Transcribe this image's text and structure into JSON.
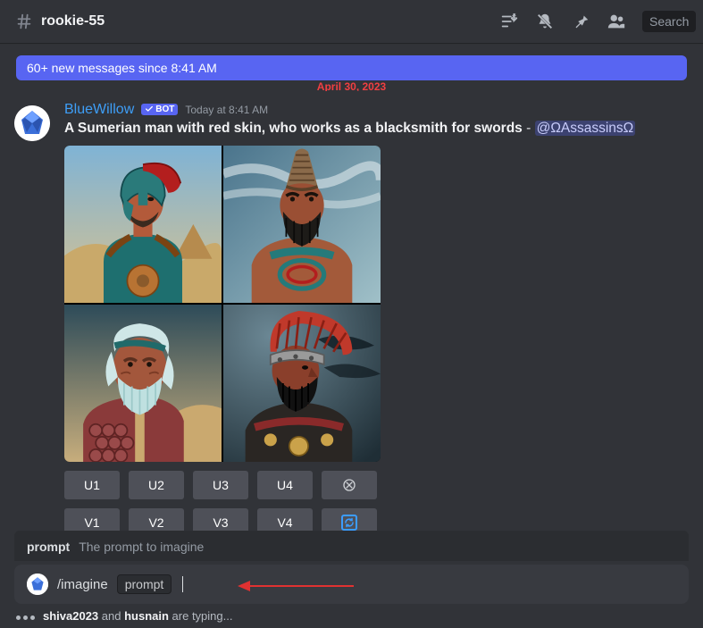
{
  "header": {
    "channel_name": "rookie-55",
    "search_placeholder": "Search"
  },
  "new_messages_bar": "60+ new messages since 8:41 AM",
  "date_divider": "April 30, 2023",
  "message": {
    "author": "BlueWillow",
    "bot_tag": "BOT",
    "timestamp": "Today at 8:41 AM",
    "prompt_text": "A Sumerian man with red skin, who works as a blacksmith for swords",
    "separator": " - ",
    "mention": "@ΩAssassinsΩ",
    "buttons_row1": [
      "U1",
      "U2",
      "U3",
      "U4"
    ],
    "buttons_row2": [
      "V1",
      "V2",
      "V3",
      "V4"
    ]
  },
  "composer": {
    "popover_name": "prompt",
    "popover_desc": "The prompt to imagine",
    "command": "/imagine",
    "param": "prompt"
  },
  "typing": {
    "user1": "shiva2023",
    "mid": " and ",
    "user2": "husnain",
    "suffix": " are typing..."
  }
}
